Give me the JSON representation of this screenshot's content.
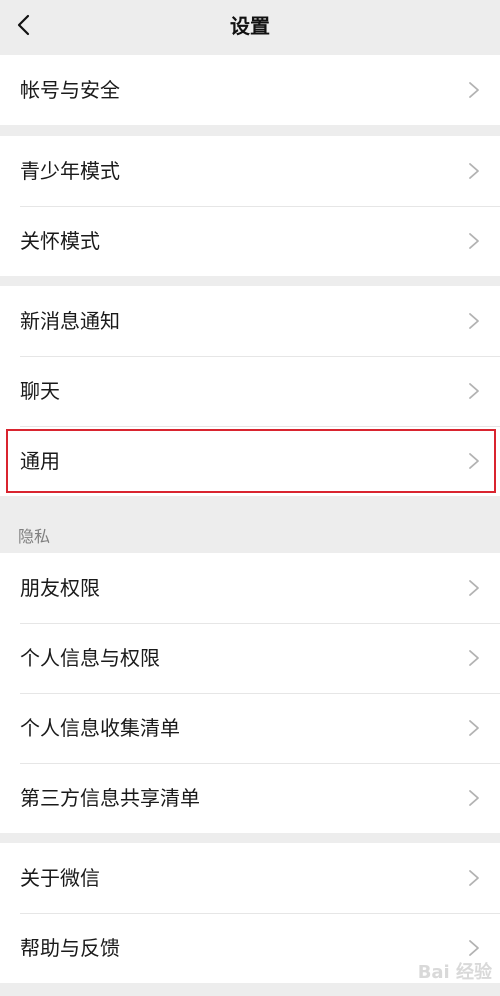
{
  "header": {
    "title": "设置",
    "back_icon": "chevron-left-icon"
  },
  "groups": [
    {
      "items": [
        {
          "label": "帐号与安全"
        }
      ]
    },
    {
      "items": [
        {
          "label": "青少年模式"
        },
        {
          "label": "关怀模式"
        }
      ]
    },
    {
      "items": [
        {
          "label": "新消息通知"
        },
        {
          "label": "聊天"
        },
        {
          "label": "通用",
          "highlighted": true
        }
      ]
    },
    {
      "section_title": "隐私",
      "items": [
        {
          "label": "朋友权限"
        },
        {
          "label": "个人信息与权限"
        },
        {
          "label": "个人信息收集清单"
        },
        {
          "label": "第三方信息共享清单"
        }
      ]
    },
    {
      "items": [
        {
          "label": "关于微信"
        },
        {
          "label": "帮助与反馈"
        }
      ]
    }
  ],
  "highlight_color": "#d9242f",
  "row_icon": "chevron-right-icon",
  "watermark": {
    "text": "Bai 经验"
  }
}
